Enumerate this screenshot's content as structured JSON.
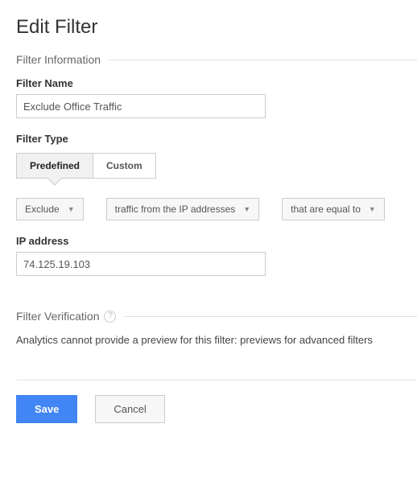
{
  "page_title": "Edit Filter",
  "sections": {
    "info_title": "Filter Information",
    "verification_title": "Filter Verification"
  },
  "fields": {
    "filter_name_label": "Filter Name",
    "filter_name_value": "Exclude Office Traffic",
    "filter_type_label": "Filter Type",
    "ip_address_label": "IP address",
    "ip_address_value": "74.125.19.103"
  },
  "filter_type_toggle": {
    "predefined": "Predefined",
    "custom": "Custom",
    "selected": "predefined"
  },
  "selects": {
    "action": "Exclude",
    "source": "traffic from the IP addresses",
    "match": "that are equal to"
  },
  "verification_message": "Analytics cannot provide a preview for this filter: previews for advanced filters",
  "actions": {
    "save": "Save",
    "cancel": "Cancel"
  }
}
